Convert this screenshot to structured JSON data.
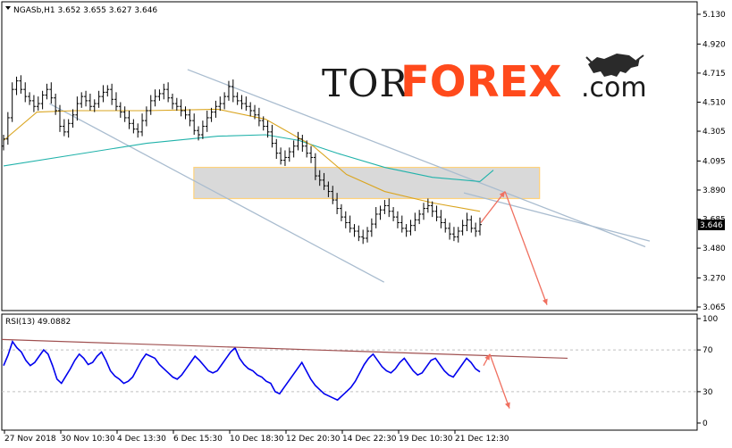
{
  "header": {
    "symbol_info": "NGASb,H1  3.652 3.655 3.627 3.646"
  },
  "rsi_header": {
    "label": "RSI(13) 49.0882"
  },
  "price_axis": {
    "ticks": [
      "5.130",
      "4.920",
      "4.715",
      "4.510",
      "4.305",
      "4.095",
      "3.890",
      "3.685",
      "3.480",
      "3.270",
      "3.065"
    ],
    "current_price": "3.646"
  },
  "rsi_axis": {
    "ticks": [
      "100",
      "70",
      "30",
      "0"
    ]
  },
  "time_axis": {
    "ticks": [
      "27 Nov 2018",
      "30 Nov 10:30",
      "4 Dec 13:30",
      "6 Dec 15:30",
      "10 Dec 18:30",
      "12 Dec 20:30",
      "14 Dec 22:30",
      "19 Dec 10:30",
      "21 Dec 12:30"
    ]
  },
  "logo": {
    "part1": "TOR",
    "part2": "FOREX",
    "part3": ".com",
    "icon": "bull-icon"
  },
  "colors": {
    "candles": "#000000",
    "ma_slow": "#20b2aa",
    "ma_fast": "#daa520",
    "channel": "#a9bccf",
    "rsi": "#0000ee",
    "rsi_trend": "#a05050",
    "arrows": "#f07060",
    "zone_fill": "#d9d9d9",
    "zone_border": "#ffd27a",
    "logo_accent": "#ff4a1c"
  },
  "chart_data": {
    "type": "candlestick",
    "symbol": "NGASb",
    "timeframe": "H1",
    "ohlc_last": {
      "open": 3.652,
      "high": 3.655,
      "low": 3.627,
      "close": 3.646
    },
    "close_series": [
      4.25,
      4.4,
      4.6,
      4.66,
      4.6,
      4.55,
      4.52,
      4.48,
      4.5,
      4.56,
      4.6,
      4.54,
      4.45,
      4.34,
      4.3,
      4.36,
      4.42,
      4.5,
      4.55,
      4.52,
      4.48,
      4.5,
      4.55,
      4.58,
      4.6,
      4.53,
      4.48,
      4.44,
      4.4,
      4.36,
      4.32,
      4.3,
      4.38,
      4.45,
      4.52,
      4.55,
      4.57,
      4.6,
      4.54,
      4.5,
      4.48,
      4.45,
      4.42,
      4.38,
      4.31,
      4.28,
      4.34,
      4.4,
      4.44,
      4.48,
      4.5,
      4.55,
      4.62,
      4.55,
      4.52,
      4.5,
      4.48,
      4.45,
      4.42,
      4.38,
      4.34,
      4.3,
      4.22,
      4.15,
      4.1,
      4.12,
      4.16,
      4.2,
      4.25,
      4.2,
      4.15,
      4.12,
      3.99,
      3.96,
      3.92,
      3.88,
      3.82,
      3.76,
      3.7,
      3.66,
      3.62,
      3.6,
      3.56,
      3.55,
      3.6,
      3.65,
      3.72,
      3.75,
      3.78,
      3.74,
      3.7,
      3.66,
      3.62,
      3.6,
      3.64,
      3.68,
      3.72,
      3.76,
      3.78,
      3.74,
      3.7,
      3.66,
      3.62,
      3.58,
      3.56,
      3.6,
      3.64,
      3.68,
      3.62,
      3.6,
      3.646
    ],
    "moving_averages": [
      {
        "color": "#20b2aa",
        "points": [
          [
            0,
            4.06
          ],
          [
            0.15,
            4.14
          ],
          [
            0.3,
            4.22
          ],
          [
            0.45,
            4.27
          ],
          [
            0.55,
            4.28
          ],
          [
            0.62,
            4.24
          ],
          [
            0.7,
            4.15
          ],
          [
            0.8,
            4.05
          ],
          [
            0.9,
            3.98
          ],
          [
            1.0,
            3.95
          ]
        ]
      },
      {
        "color": "#daa520",
        "points": [
          [
            0,
            4.24
          ],
          [
            0.07,
            4.44
          ],
          [
            0.15,
            4.45
          ],
          [
            0.3,
            4.45
          ],
          [
            0.45,
            4.46
          ],
          [
            0.55,
            4.39
          ],
          [
            0.65,
            4.2
          ],
          [
            0.72,
            4.0
          ],
          [
            0.8,
            3.88
          ],
          [
            0.9,
            3.8
          ],
          [
            1.0,
            3.74
          ]
        ]
      }
    ],
    "channel_lines": [
      {
        "points": [
          [
            0.33,
            4.74
          ],
          [
            1.0,
            3.82
          ]
        ]
      },
      {
        "points": [
          [
            0.04,
            4.5
          ],
          [
            0.78,
            3.24
          ]
        ]
      },
      {
        "points": [
          [
            0.91,
            3.87
          ],
          [
            1.15,
            3.53
          ]
        ]
      }
    ],
    "zone": {
      "x_from": 0.33,
      "x_to": 0.975,
      "price_from": 3.83,
      "price_to": 4.05
    },
    "forecast_arrows": [
      {
        "points": [
          [
            0.865,
            3.66
          ],
          [
            0.905,
            3.88
          ]
        ]
      },
      {
        "points": [
          [
            0.905,
            3.88
          ],
          [
            0.975,
            3.08
          ]
        ]
      }
    ],
    "rsi": {
      "period": 13,
      "last": 49.0882,
      "levels": [
        70,
        30
      ],
      "values": [
        55,
        65,
        78,
        72,
        68,
        60,
        55,
        58,
        64,
        70,
        66,
        55,
        42,
        38,
        45,
        52,
        60,
        66,
        62,
        56,
        58,
        64,
        68,
        60,
        50,
        45,
        42,
        38,
        40,
        44,
        52,
        60,
        66,
        64,
        62,
        56,
        52,
        48,
        44,
        42,
        46,
        52,
        58,
        64,
        60,
        55,
        50,
        48,
        50,
        56,
        62,
        68,
        72,
        62,
        56,
        52,
        50,
        46,
        44,
        40,
        38,
        30,
        28,
        34,
        40,
        46,
        52,
        58,
        50,
        42,
        36,
        32,
        28,
        26,
        24,
        22,
        26,
        30,
        34,
        40,
        48,
        56,
        62,
        66,
        60,
        54,
        50,
        48,
        52,
        58,
        62,
        56,
        50,
        46,
        48,
        54,
        60,
        62,
        56,
        50,
        46,
        44,
        50,
        56,
        62,
        58,
        52,
        49
      ]
    },
    "rsi_trendline": {
      "points": [
        [
          0,
          80
        ],
        [
          1.0,
          62
        ]
      ]
    },
    "rsi_arrows": [
      {
        "points": [
          [
            0.87,
            55
          ],
          [
            0.92,
            66
          ]
        ]
      },
      {
        "points": [
          [
            0.92,
            66
          ],
          [
            0.975,
            14
          ]
        ]
      }
    ]
  }
}
